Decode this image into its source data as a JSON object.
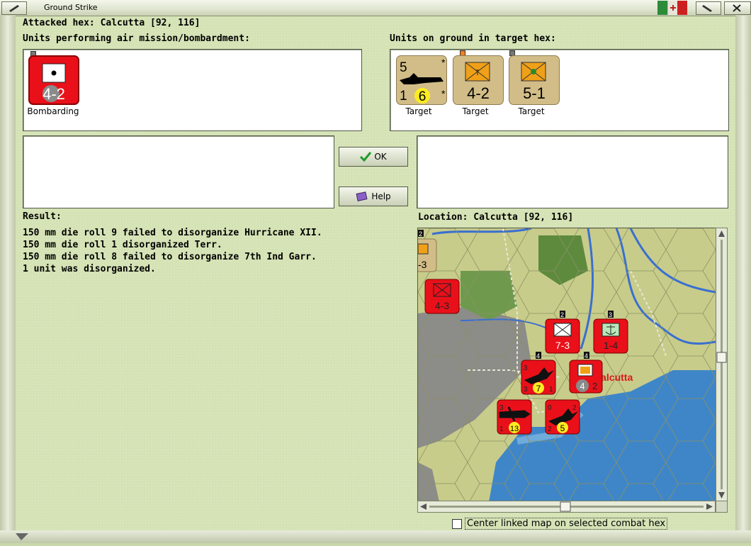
{
  "window": {
    "title": "Ground Strike"
  },
  "attacked_hex": "Attacked hex: Calcutta  [92, 116]",
  "air_units_label": "Units performing air mission/bombardment:",
  "ground_units_label": "Units on ground in target hex:",
  "air_units": [
    {
      "value": "4-2",
      "caption": "Bombarding",
      "color": "#e9101a"
    }
  ],
  "ground_units": [
    {
      "top_left": "5",
      "bottom_left": "1",
      "circle": "6",
      "star_top": "*",
      "star_bottom": "*",
      "caption": "Target"
    },
    {
      "value": "4-2",
      "caption": "Target"
    },
    {
      "value": "5-1",
      "caption": "Target"
    }
  ],
  "buttons": {
    "ok": "OK",
    "help": "Help"
  },
  "result_label": "Result:",
  "result_lines": [
    "150 mm die roll 9 failed to disorganize Hurricane XII.",
    "150 mm die roll 1 disorganized Terr.",
    "150 mm die roll 8 failed to disorganize 7th Ind Garr.",
    "1 unit was disorganized."
  ],
  "location_label": "Location:  Calcutta  [92, 116]",
  "map": {
    "city_label": "Calcutta",
    "counters": [
      {
        "id": "edge-unit",
        "value": "-3",
        "stack": "2"
      },
      {
        "id": "inf-unit",
        "value": "4-3"
      },
      {
        "id": "unit-7-3",
        "value": "7-3",
        "stack": "2"
      },
      {
        "id": "unit-1-4",
        "value": "1-4",
        "stack": "3"
      },
      {
        "id": "bomber-1",
        "tl": "3",
        "bl": "3",
        "br": "1",
        "circle": "7",
        "stack": "4"
      },
      {
        "id": "calcutta-unit",
        "value": "2",
        "circle": "4",
        "stack": "4"
      },
      {
        "id": "bomber-2",
        "tl": "3",
        "bl": "1",
        "circle": "13"
      },
      {
        "id": "bomber-3",
        "tl": "0",
        "tr": "2",
        "bl": "2",
        "circle": "5"
      }
    ]
  },
  "checkbox_label": "Center linked map on selected combat hex",
  "colors": {
    "background": "#d4e2b4",
    "unit_red": "#e9101a",
    "unit_tan": "#d2bd88",
    "sea": "#3f86c8"
  }
}
